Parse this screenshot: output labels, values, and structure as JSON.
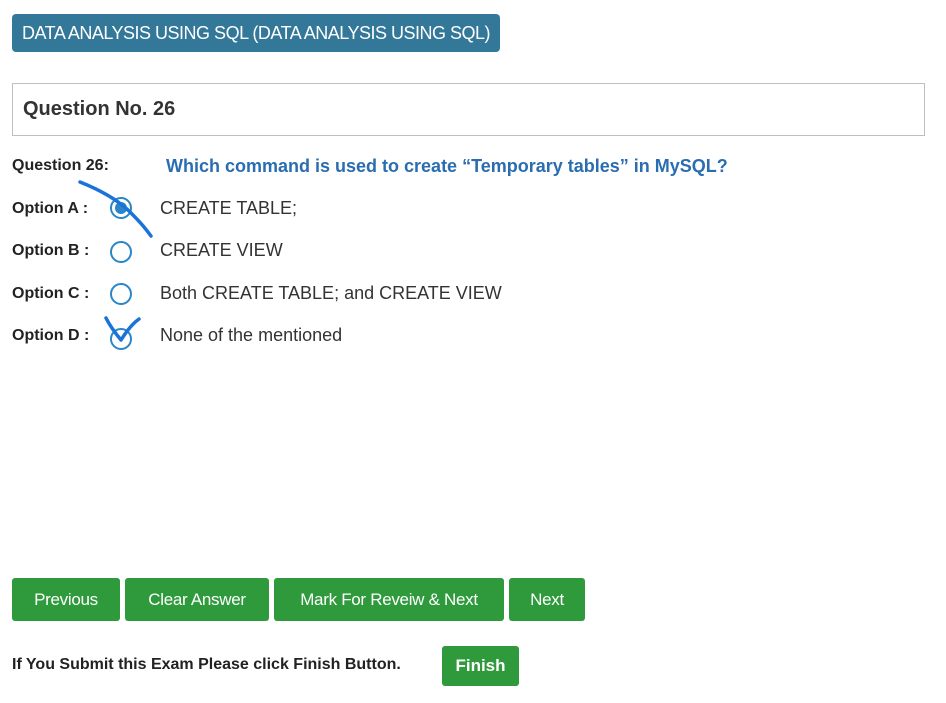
{
  "header": {
    "subject": "DATA ANALYSIS USING SQL (DATA ANALYSIS USING SQL)"
  },
  "question": {
    "number_title": "Question No. 26",
    "label": "Question 26:",
    "text": "Which command is used to create “Temporary tables” in MySQL?"
  },
  "options": [
    {
      "label": "Option A :",
      "text": "CREATE TABLE;",
      "selected": true
    },
    {
      "label": "Option B :",
      "text": "CREATE VIEW",
      "selected": false
    },
    {
      "label": "Option C :",
      "text": "Both CREATE TABLE; and CREATE VIEW",
      "selected": false
    },
    {
      "label": "Option D :",
      "text": "None of the mentioned",
      "selected": false
    }
  ],
  "buttons": {
    "previous": "Previous",
    "clear": "Clear Answer",
    "mark_review": "Mark For Reveiw & Next",
    "next": "Next",
    "finish": "Finish"
  },
  "footer": {
    "note": "If You Submit this Exam Please click Finish Button."
  },
  "colors": {
    "badge_bg": "#337799",
    "question_text": "#2a6db0",
    "button_green": "#2e9a3c",
    "radio_blue": "#2a86c8",
    "pen_ink": "#1a73d9"
  },
  "annotations": [
    {
      "type": "strike-through",
      "target": "option A"
    },
    {
      "type": "check-mark",
      "target": "option D"
    }
  ]
}
